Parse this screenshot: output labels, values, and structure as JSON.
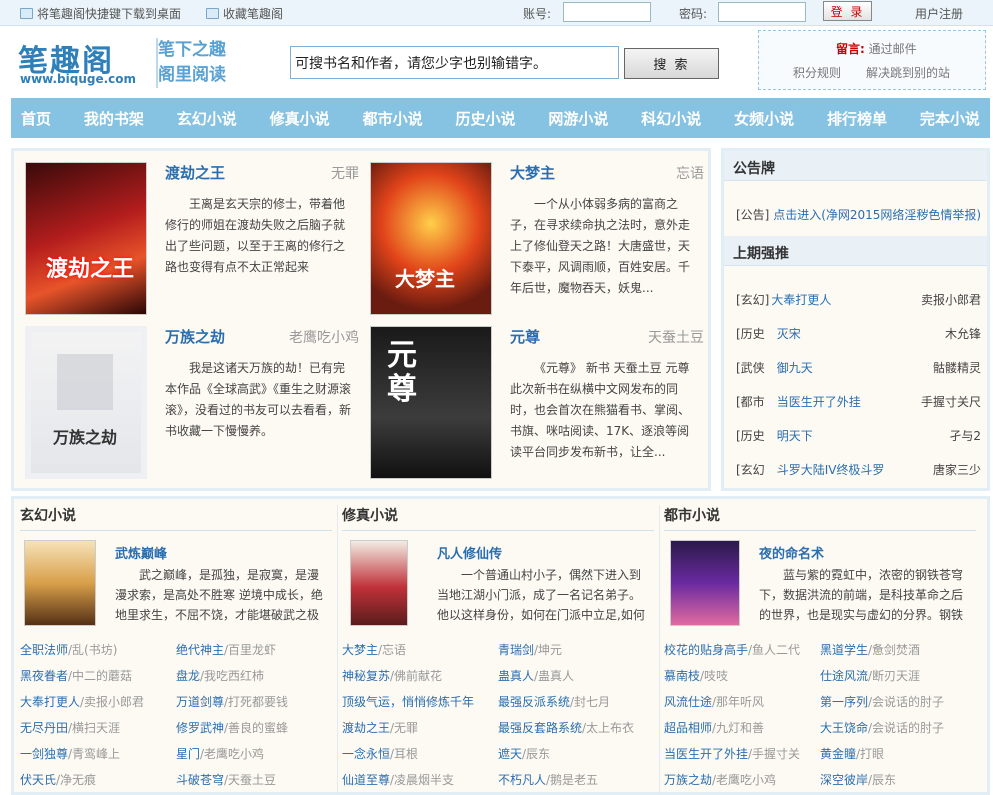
{
  "topbar": {
    "shortcut": "将笔趣阁快捷键下载到桌面",
    "bookmark": "收藏笔趣阁",
    "account_label": "账号:",
    "password_label": "密码:",
    "login": "登 录",
    "register": "用户注册"
  },
  "header": {
    "logo": "笔趣阁",
    "logo_url": "www.biquge.com",
    "slogan_line1": "笔下之趣",
    "slogan_line2": "阁里阅读",
    "search_value": "可搜书名和作者，请您少字也别输错字。",
    "search_button": "搜 索",
    "notice_label": "留言:",
    "notice_text": "通过邮件",
    "rules": "积分规则",
    "domain": "解决跳到别的站"
  },
  "nav": [
    "首页",
    "我的书架",
    "玄幻小说",
    "修真小说",
    "都市小说",
    "历史小说",
    "网游小说",
    "科幻小说",
    "女频小说",
    "排行榜单",
    "完本小说"
  ],
  "featured": [
    {
      "title": "渡劫之王",
      "author": "无罪",
      "desc": "王离是玄天宗的修士，带着他修行的师姐在渡劫失败之后脑子就出了些问题，以至于王离的修行之路也变得有点不太正常起来",
      "cover_text": "渡劫之王"
    },
    {
      "title": "大梦主",
      "author": "忘语",
      "desc": "一个从小体弱多病的富商之子，在寻求续命执之法时，意外走上了修仙登天之路！大唐盛世，天下泰平，风调雨顺，百姓安居。千年后世，魔物吞天，妖鬼...",
      "cover_text": "大梦主"
    },
    {
      "title": "万族之劫",
      "author": "老鹰吃小鸡",
      "desc": "我是这诸天万族的劫！已有完本作品《全球高武》《重生之财源滚滚》，没看过的书友可以去看看，新书收藏一下慢慢养。",
      "cover_text": "万族之劫"
    },
    {
      "title": "元尊",
      "author": "天蚕土豆",
      "desc": "《元尊》 新书 天蚕土豆 元尊此次新书在纵横中文网发布的同时，也会首次在熊猫看书、掌阅、书旗、咪咕阅读、17K、逐浪等阅读平台同步发布新书，让全...",
      "cover_text": "元尊"
    }
  ],
  "sidebar": {
    "notice_title": "公告牌",
    "notice_cat": "[公告]",
    "notice_link": "点击进入(净网2015网络淫秽色情举报)",
    "rec_title": "上期强推",
    "rec": [
      {
        "cat": "[玄幻]",
        "book": "大奉打更人",
        "author": "卖报小郎君"
      },
      {
        "cat": "[历史",
        "book": "灭宋",
        "author": "木允锋"
      },
      {
        "cat": "[武侠",
        "book": "御九天",
        "author": "骷髅精灵"
      },
      {
        "cat": "[都市",
        "book": "当医生开了外挂",
        "author": "手握寸关尺"
      },
      {
        "cat": "[历史",
        "book": "明天下",
        "author": "孑与2"
      },
      {
        "cat": "[玄幻",
        "book": "斗罗大陆IV终极斗罗",
        "author": "唐家三少"
      }
    ]
  },
  "columns": [
    {
      "title": "玄幻小说",
      "feat_title": "武炼巅峰",
      "feat_desc": "武之巅峰，是孤独，是寂寞，是漫漫求索，是高处不胜寒 逆境中成长，绝地里求生，不屈不饶，才能堪破武之极道。",
      "items": [
        {
          "book": "全职法师",
          "author": "/乱(书坊)"
        },
        {
          "book": "绝代神主",
          "author": "/百里龙虾"
        },
        {
          "book": "黑夜眷者",
          "author": "/中二的蘑菇"
        },
        {
          "book": "盘龙",
          "author": "/我吃西红柿"
        },
        {
          "book": "大奉打更人",
          "author": "/卖报小郎君"
        },
        {
          "book": "万道剑尊",
          "author": "/打死都要钱"
        },
        {
          "book": "无尽丹田",
          "author": "/横扫天涯"
        },
        {
          "book": "修罗武神",
          "author": "/善良的蜜蜂"
        },
        {
          "book": "一剑独尊",
          "author": "/青鸾峰上"
        },
        {
          "book": "星门",
          "author": "/老鹰吃小鸡"
        },
        {
          "book": "伏天氏",
          "author": "/净无痕"
        },
        {
          "book": "斗破苍穹",
          "author": "/天蚕土豆"
        }
      ]
    },
    {
      "title": "修真小说",
      "feat_title": "凡人修仙传",
      "feat_desc": "一个普通山村小子，偶然下进入到当地江湖小门派，成了一名记名弟子。他以这样身份，如何在门派中立足,如何以平庸的",
      "items": [
        {
          "book": "大梦主",
          "author": "/忘语"
        },
        {
          "book": "青瑞剑",
          "author": "/坤元"
        },
        {
          "book": "神秘复苏",
          "author": "/佛前献花"
        },
        {
          "book": "蛊真人",
          "author": "/蛊真人"
        },
        {
          "book": "顶级气运，悄悄修炼千年",
          "author": ""
        },
        {
          "book": "最强反派系统",
          "author": "/封七月"
        },
        {
          "book": "渡劫之王",
          "author": "/无罪"
        },
        {
          "book": "最强反套路系统",
          "author": "/太上布衣"
        },
        {
          "book": "一念永恒",
          "author": "/耳根"
        },
        {
          "book": "遮天",
          "author": "/辰东"
        },
        {
          "book": "仙道至尊",
          "author": "/凌晨烟半支"
        },
        {
          "book": "不朽凡人",
          "author": "/鹅是老五"
        }
      ]
    },
    {
      "title": "都市小说",
      "feat_title": "夜的命名术",
      "feat_desc": "蓝与紫的霓虹中，浓密的钢铁苍穹下，数据洪流的前端，是科技革命之后的世界，也是现实与虚幻的分界。钢铁与身",
      "items": [
        {
          "book": "校花的贴身高手",
          "author": "/鱼人二代"
        },
        {
          "book": "黑道学生",
          "author": "/惫剑焚酒"
        },
        {
          "book": "慕南枝",
          "author": "/吱吱"
        },
        {
          "book": "仕途风流",
          "author": "/断刃天涯"
        },
        {
          "book": "风流仕途",
          "author": "/那年听风"
        },
        {
          "book": "第一序列",
          "author": "/会说话的肘子"
        },
        {
          "book": "超品相师",
          "author": "/九灯和善"
        },
        {
          "book": "大王饶命",
          "author": "/会说话的肘子"
        },
        {
          "book": "当医生开了外挂",
          "author": "/手握寸关"
        },
        {
          "book": "黄金瞳",
          "author": "/打眼"
        },
        {
          "book": "万族之劫",
          "author": "/老鹰吃小鸡"
        },
        {
          "book": "深空彼岸",
          "author": "/辰东"
        }
      ]
    }
  ],
  "colors": {
    "accent": "#2a6eb0",
    "nav": "#86c2e2",
    "panel": "#fcfaf3",
    "border": "#e1eef6"
  }
}
